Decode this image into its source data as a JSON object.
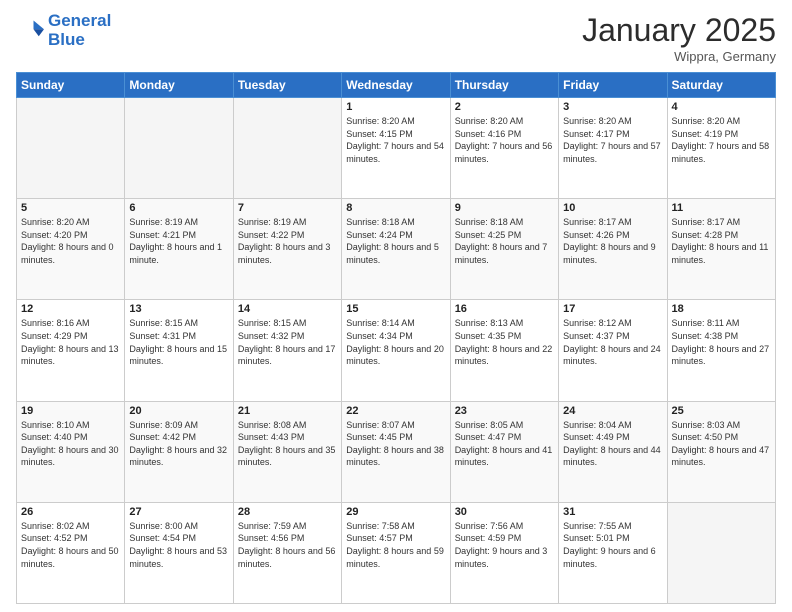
{
  "header": {
    "logo_line1": "General",
    "logo_line2": "Blue",
    "month": "January 2025",
    "location": "Wippra, Germany"
  },
  "weekdays": [
    "Sunday",
    "Monday",
    "Tuesday",
    "Wednesday",
    "Thursday",
    "Friday",
    "Saturday"
  ],
  "weeks": [
    [
      {
        "day": "",
        "info": ""
      },
      {
        "day": "",
        "info": ""
      },
      {
        "day": "",
        "info": ""
      },
      {
        "day": "1",
        "info": "Sunrise: 8:20 AM\nSunset: 4:15 PM\nDaylight: 7 hours\nand 54 minutes."
      },
      {
        "day": "2",
        "info": "Sunrise: 8:20 AM\nSunset: 4:16 PM\nDaylight: 7 hours\nand 56 minutes."
      },
      {
        "day": "3",
        "info": "Sunrise: 8:20 AM\nSunset: 4:17 PM\nDaylight: 7 hours\nand 57 minutes."
      },
      {
        "day": "4",
        "info": "Sunrise: 8:20 AM\nSunset: 4:19 PM\nDaylight: 7 hours\nand 58 minutes."
      }
    ],
    [
      {
        "day": "5",
        "info": "Sunrise: 8:20 AM\nSunset: 4:20 PM\nDaylight: 8 hours\nand 0 minutes."
      },
      {
        "day": "6",
        "info": "Sunrise: 8:19 AM\nSunset: 4:21 PM\nDaylight: 8 hours\nand 1 minute."
      },
      {
        "day": "7",
        "info": "Sunrise: 8:19 AM\nSunset: 4:22 PM\nDaylight: 8 hours\nand 3 minutes."
      },
      {
        "day": "8",
        "info": "Sunrise: 8:18 AM\nSunset: 4:24 PM\nDaylight: 8 hours\nand 5 minutes."
      },
      {
        "day": "9",
        "info": "Sunrise: 8:18 AM\nSunset: 4:25 PM\nDaylight: 8 hours\nand 7 minutes."
      },
      {
        "day": "10",
        "info": "Sunrise: 8:17 AM\nSunset: 4:26 PM\nDaylight: 8 hours\nand 9 minutes."
      },
      {
        "day": "11",
        "info": "Sunrise: 8:17 AM\nSunset: 4:28 PM\nDaylight: 8 hours\nand 11 minutes."
      }
    ],
    [
      {
        "day": "12",
        "info": "Sunrise: 8:16 AM\nSunset: 4:29 PM\nDaylight: 8 hours\nand 13 minutes."
      },
      {
        "day": "13",
        "info": "Sunrise: 8:15 AM\nSunset: 4:31 PM\nDaylight: 8 hours\nand 15 minutes."
      },
      {
        "day": "14",
        "info": "Sunrise: 8:15 AM\nSunset: 4:32 PM\nDaylight: 8 hours\nand 17 minutes."
      },
      {
        "day": "15",
        "info": "Sunrise: 8:14 AM\nSunset: 4:34 PM\nDaylight: 8 hours\nand 20 minutes."
      },
      {
        "day": "16",
        "info": "Sunrise: 8:13 AM\nSunset: 4:35 PM\nDaylight: 8 hours\nand 22 minutes."
      },
      {
        "day": "17",
        "info": "Sunrise: 8:12 AM\nSunset: 4:37 PM\nDaylight: 8 hours\nand 24 minutes."
      },
      {
        "day": "18",
        "info": "Sunrise: 8:11 AM\nSunset: 4:38 PM\nDaylight: 8 hours\nand 27 minutes."
      }
    ],
    [
      {
        "day": "19",
        "info": "Sunrise: 8:10 AM\nSunset: 4:40 PM\nDaylight: 8 hours\nand 30 minutes."
      },
      {
        "day": "20",
        "info": "Sunrise: 8:09 AM\nSunset: 4:42 PM\nDaylight: 8 hours\nand 32 minutes."
      },
      {
        "day": "21",
        "info": "Sunrise: 8:08 AM\nSunset: 4:43 PM\nDaylight: 8 hours\nand 35 minutes."
      },
      {
        "day": "22",
        "info": "Sunrise: 8:07 AM\nSunset: 4:45 PM\nDaylight: 8 hours\nand 38 minutes."
      },
      {
        "day": "23",
        "info": "Sunrise: 8:05 AM\nSunset: 4:47 PM\nDaylight: 8 hours\nand 41 minutes."
      },
      {
        "day": "24",
        "info": "Sunrise: 8:04 AM\nSunset: 4:49 PM\nDaylight: 8 hours\nand 44 minutes."
      },
      {
        "day": "25",
        "info": "Sunrise: 8:03 AM\nSunset: 4:50 PM\nDaylight: 8 hours\nand 47 minutes."
      }
    ],
    [
      {
        "day": "26",
        "info": "Sunrise: 8:02 AM\nSunset: 4:52 PM\nDaylight: 8 hours\nand 50 minutes."
      },
      {
        "day": "27",
        "info": "Sunrise: 8:00 AM\nSunset: 4:54 PM\nDaylight: 8 hours\nand 53 minutes."
      },
      {
        "day": "28",
        "info": "Sunrise: 7:59 AM\nSunset: 4:56 PM\nDaylight: 8 hours\nand 56 minutes."
      },
      {
        "day": "29",
        "info": "Sunrise: 7:58 AM\nSunset: 4:57 PM\nDaylight: 8 hours\nand 59 minutes."
      },
      {
        "day": "30",
        "info": "Sunrise: 7:56 AM\nSunset: 4:59 PM\nDaylight: 9 hours\nand 3 minutes."
      },
      {
        "day": "31",
        "info": "Sunrise: 7:55 AM\nSunset: 5:01 PM\nDaylight: 9 hours\nand 6 minutes."
      },
      {
        "day": "",
        "info": ""
      }
    ]
  ]
}
